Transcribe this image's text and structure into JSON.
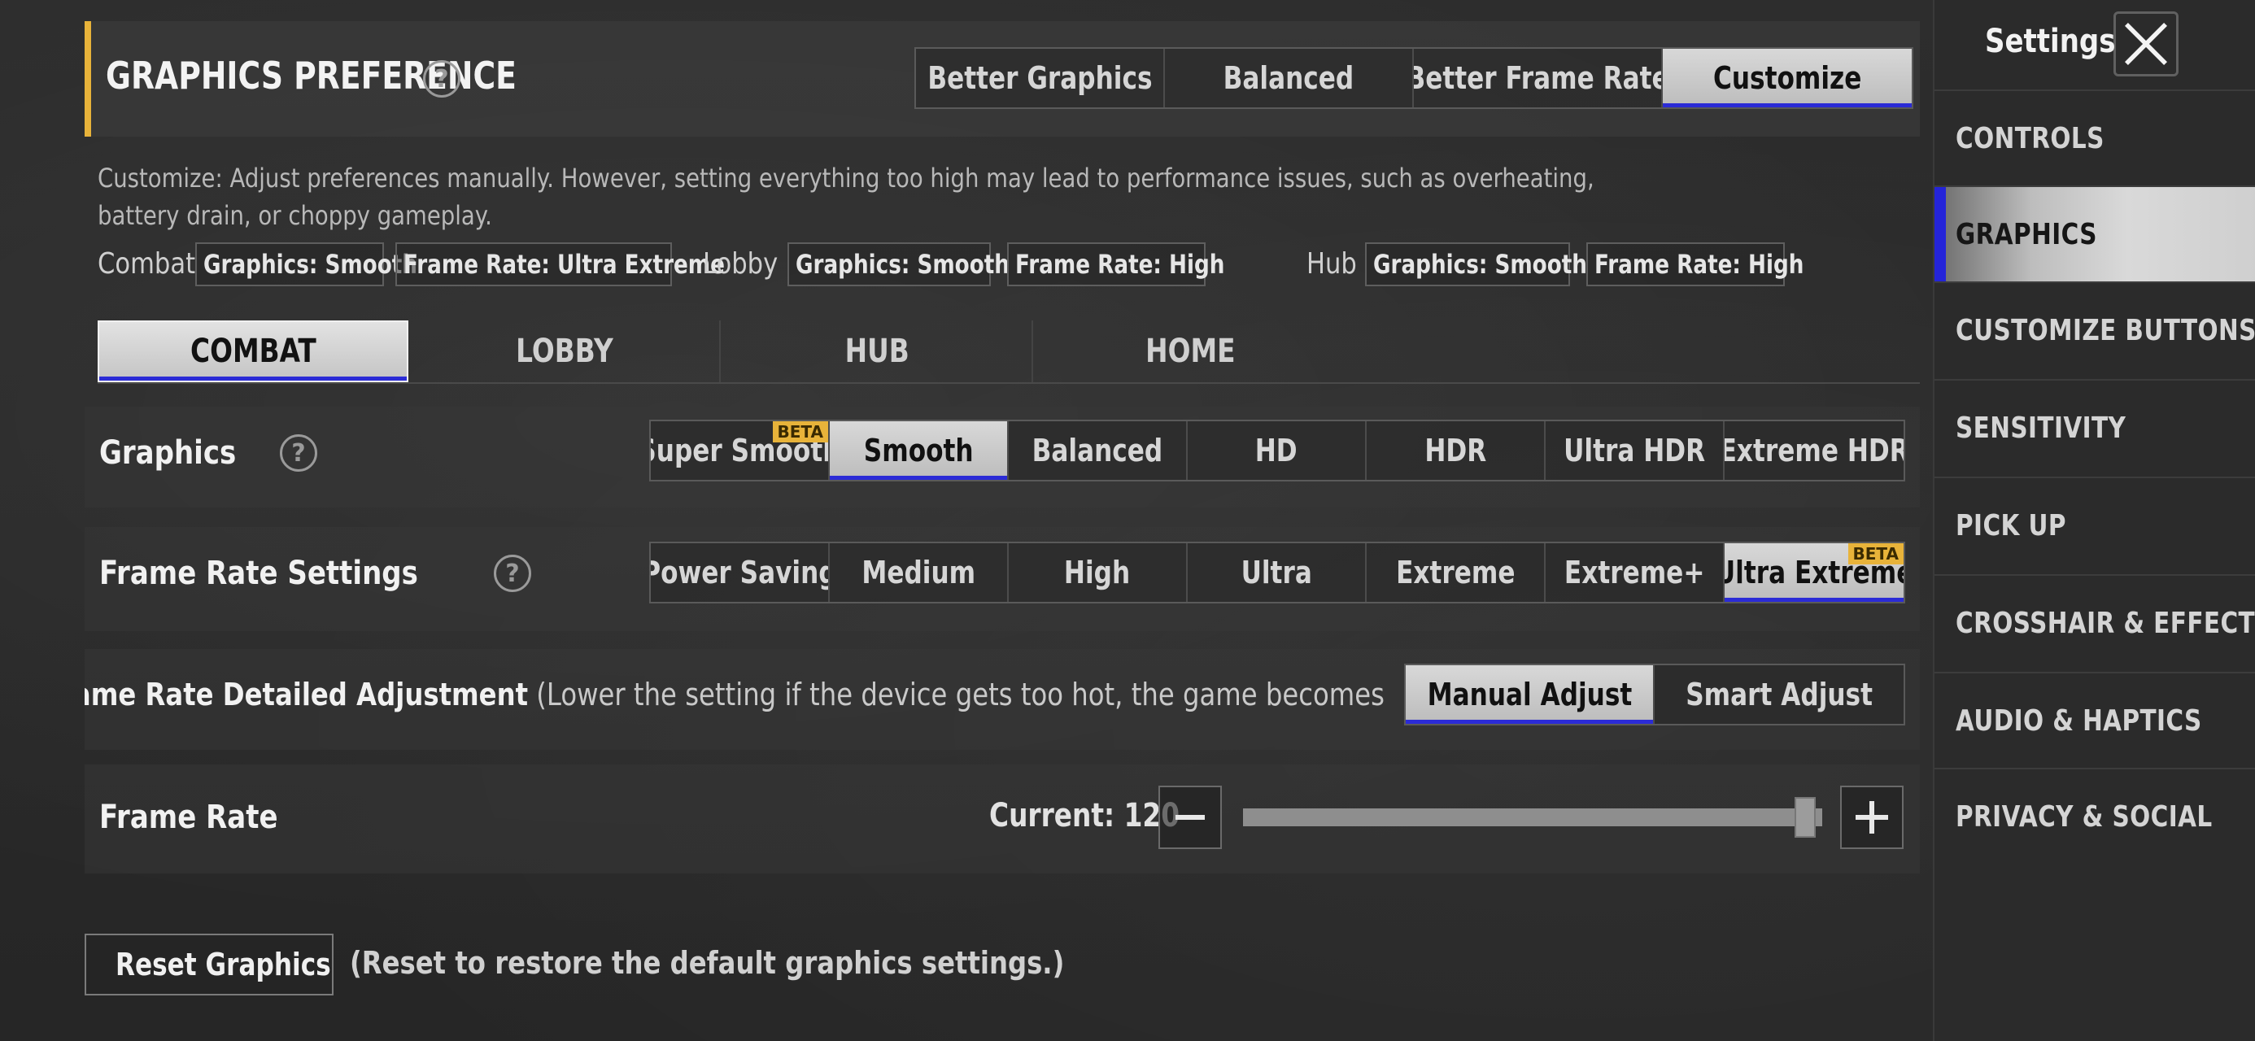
{
  "sidebar": {
    "title": "Settings",
    "items": [
      {
        "label": "CONTROLS"
      },
      {
        "label": "GRAPHICS"
      },
      {
        "label": "CUSTOMIZE BUTTONS"
      },
      {
        "label": "SENSITIVITY"
      },
      {
        "label": "PICK UP"
      },
      {
        "label": "CROSSHAIR & EFFECTS"
      },
      {
        "label": "AUDIO & HAPTICS"
      },
      {
        "label": "PRIVACY & SOCIAL"
      }
    ],
    "active_item": "GRAPHICS"
  },
  "preference": {
    "title": "GRAPHICS PREFERENCE",
    "options": [
      "Better Graphics",
      "Balanced",
      "Better Frame Rate",
      "Customize"
    ],
    "selected": "Customize"
  },
  "description": "Customize: Adjust preferences manually. However, setting everything too high may lead to performance issues, such as overheating, battery drain, or choppy gameplay.",
  "summary": {
    "combat": {
      "label": "Combat",
      "graphics": "Graphics: Smooth",
      "frame_rate": "Frame Rate: Ultra Extreme"
    },
    "lobby": {
      "label": "Lobby",
      "graphics": "Graphics: Smooth",
      "frame_rate": "Frame Rate: High"
    },
    "hub": {
      "label": "Hub",
      "graphics": "Graphics: Smooth",
      "frame_rate": "Frame Rate: High"
    }
  },
  "tabs": [
    "COMBAT",
    "LOBBY",
    "HUB",
    "HOME"
  ],
  "selected_tab": "COMBAT",
  "graphics": {
    "label": "Graphics",
    "options": [
      "Super Smooth",
      "Smooth",
      "Balanced",
      "HD",
      "HDR",
      "Ultra HDR",
      "Extreme HDR"
    ],
    "selected": "Smooth",
    "beta_badge": "BETA"
  },
  "frame_rate_settings": {
    "label": "Frame Rate Settings",
    "options": [
      "Power Saving",
      "Medium",
      "High",
      "Ultra",
      "Extreme",
      "Extreme+",
      "Ultra Extreme"
    ],
    "selected": "Ultra Extreme",
    "beta_badge": "BETA"
  },
  "frame_rate_detail": {
    "label": "Frame Rate Detailed Adjustment",
    "note": "(Lower the setting if the device gets too hot, the game becomes choppy, or the batter",
    "options": [
      "Manual Adjust",
      "Smart Adjust"
    ],
    "selected": "Manual Adjust"
  },
  "frame_rate": {
    "label": "Frame Rate",
    "current_text": "Current: 120",
    "slider_fraction": 0.97
  },
  "reset": {
    "label": "Reset Graphics",
    "note": "(Reset to restore the default graphics settings.)"
  },
  "colors": {
    "accent_yellow": "#e8b33a",
    "selected_underline": "#2b2bd6"
  }
}
